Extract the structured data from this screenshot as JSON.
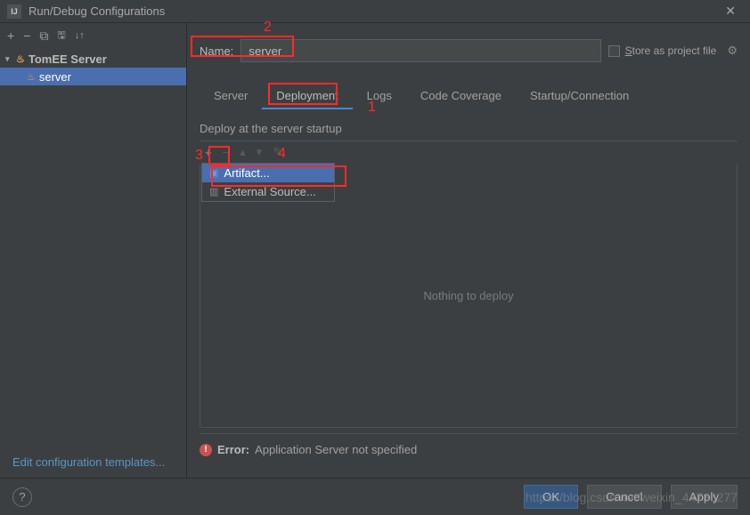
{
  "titlebar": {
    "icon_text": "IJ",
    "title": "Run/Debug Configurations"
  },
  "sidebar": {
    "tree": {
      "root": {
        "label": "TomEE Server"
      },
      "child": {
        "label": "server"
      }
    },
    "footer_link": "Edit configuration templates..."
  },
  "name_row": {
    "label": "Name:",
    "value": "server",
    "store_label": "Store as project file"
  },
  "tabs": {
    "items": [
      "Server",
      "Deployment",
      "Logs",
      "Code Coverage",
      "Startup/Connection"
    ],
    "active_index": 1
  },
  "deploy": {
    "section_label": "Deploy at the server startup",
    "dropdown": {
      "item0": "Artifact...",
      "item1": "External Source..."
    },
    "empty_text": "Nothing to deploy"
  },
  "error": {
    "label": "Error:",
    "message": "Application Server not specified"
  },
  "footer": {
    "ok": "OK",
    "cancel": "Cancel",
    "apply": "Apply"
  },
  "annotations": {
    "n1": "1",
    "n2": "2",
    "n3": "3",
    "n4": "4"
  },
  "watermark": "https://blog.csdn.net/weixin_44736277"
}
